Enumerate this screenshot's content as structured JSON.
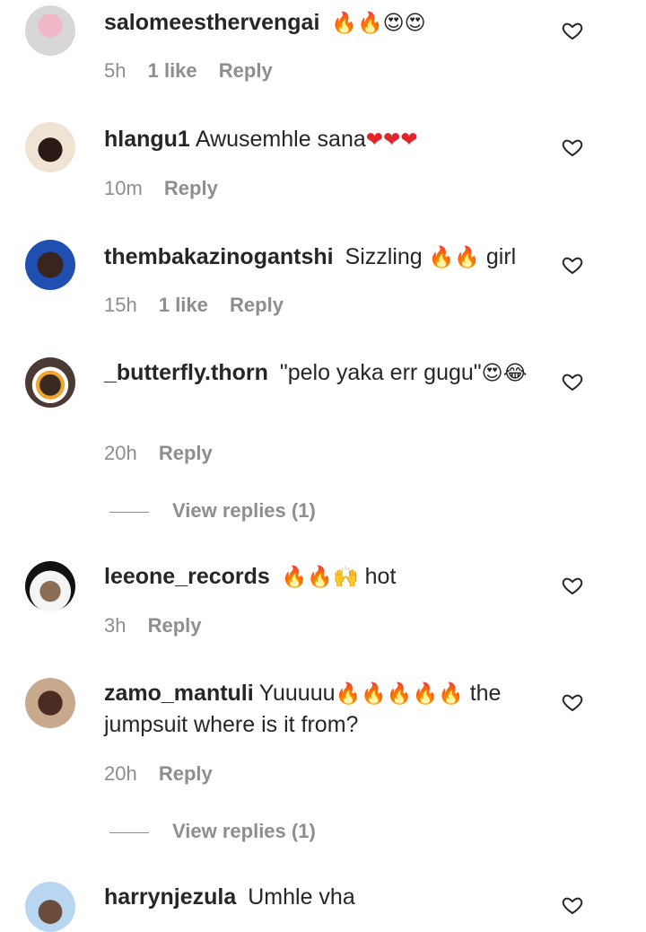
{
  "comments": [
    {
      "username": "salomeesthervengai",
      "text": "",
      "emoji": "🔥🔥😍😍",
      "time": "5h",
      "likes": "1 like",
      "reply": "Reply"
    },
    {
      "username": "hlangu1",
      "text": "Awusemhle sana",
      "emoji": "❤❤❤",
      "time": "10m",
      "likes": "",
      "reply": "Reply"
    },
    {
      "username": "thembakazinogantshi",
      "text": "Sizzling",
      "emoji": "🔥🔥",
      "text_after": "girl",
      "time": "15h",
      "likes": "1 like",
      "reply": "Reply"
    },
    {
      "username": "_butterfly.thorn",
      "text": "\"pelo yaka err gugu\"",
      "emoji": "😍😂",
      "time": "20h",
      "likes": "",
      "reply": "Reply",
      "view_replies": "View replies (1)"
    },
    {
      "username": "leeone_records",
      "text": "",
      "emoji": "🔥🔥🙌",
      "text_after": "hot",
      "time": "3h",
      "likes": "",
      "reply": "Reply"
    },
    {
      "username": "zamo_mantuli",
      "text": "Yuuuuu",
      "emoji": "🔥🔥🔥🔥🔥",
      "text_after": "the jumpsuit where is it from?",
      "time": "20h",
      "likes": "",
      "reply": "Reply",
      "view_replies": "View replies (1)"
    },
    {
      "username": "harrynjezula",
      "text": "Umhle vha",
      "emoji": "",
      "time": "",
      "likes": "",
      "reply": ""
    }
  ],
  "icons": {
    "like": "heart-outline-icon"
  },
  "colors": {
    "text": "#262626",
    "muted": "#8e8e8e"
  }
}
